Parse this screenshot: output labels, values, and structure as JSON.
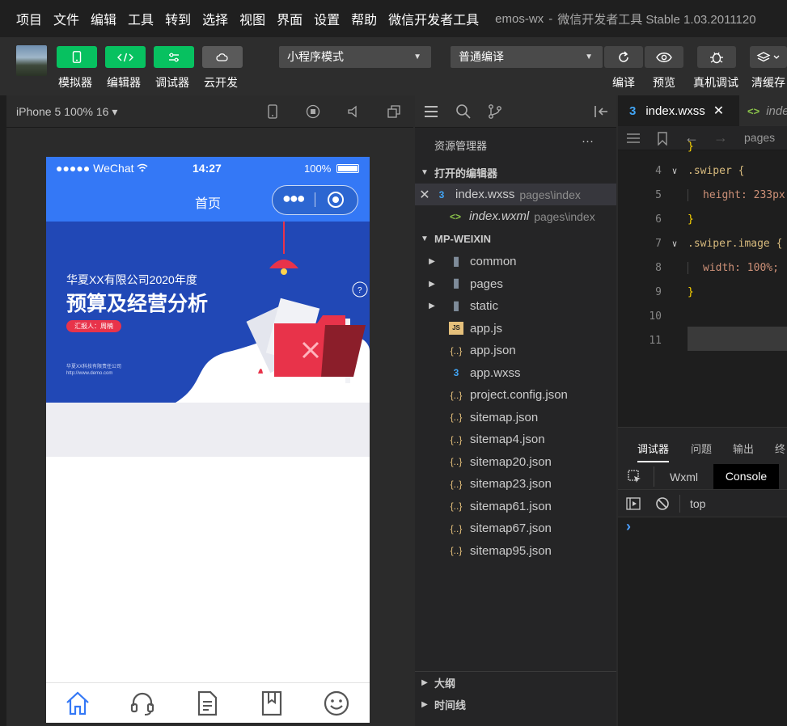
{
  "menubar": {
    "items": [
      "项目",
      "文件",
      "编辑",
      "工具",
      "转到",
      "选择",
      "视图",
      "界面",
      "设置",
      "帮助",
      "微信开发者工具"
    ],
    "title_app": "emos-wx",
    "title_sep": "-",
    "title_rest": "微信开发者工具 Stable 1.03.2011120"
  },
  "toolbar": {
    "buttons": [
      {
        "label": "模拟器",
        "icon": "phone-icon"
      },
      {
        "label": "编辑器",
        "icon": "code-icon"
      },
      {
        "label": "调试器",
        "icon": "debug-icon"
      },
      {
        "label": "云开发",
        "icon": "cloud-icon"
      }
    ],
    "mode_select": "小程序模式",
    "compile_select": "普通编译",
    "right_buttons": [
      {
        "label": "编译",
        "icon": "refresh-icon"
      },
      {
        "label": "预览",
        "icon": "eye-icon"
      },
      {
        "label": "真机调试",
        "icon": "bug-icon"
      },
      {
        "label": "清缓存",
        "icon": "layers-icon"
      }
    ]
  },
  "simulator": {
    "device_select": "iPhone 5 100% 16 ▾",
    "status": {
      "carrier": "●●●●● WeChat",
      "time": "14:27",
      "battery": "100%"
    },
    "nav_title": "首页",
    "banner": {
      "company": "华夏XX有限公司2020年度",
      "headline": "预算及经营分析",
      "reporter": "汇报人：周楠",
      "footer1": "华夏XX科技有限责任公司",
      "footer2": "http://www.demo.com"
    },
    "tabbar_icons": [
      "home-icon",
      "headset-icon",
      "document-icon",
      "bookmark-icon",
      "smile-icon"
    ]
  },
  "explorer": {
    "title": "资源管理器",
    "more": "···",
    "open_editors_label": "打开的编辑器",
    "open_editors": [
      {
        "name": "index.wxss",
        "path": "pages\\index"
      },
      {
        "name": "index.wxml",
        "path": "pages\\index"
      }
    ],
    "project_label": "MP-WEIXIN",
    "files": [
      {
        "name": "common",
        "kind": "folder"
      },
      {
        "name": "pages",
        "kind": "folder"
      },
      {
        "name": "static",
        "kind": "folder"
      },
      {
        "name": "app.js",
        "kind": "js"
      },
      {
        "name": "app.json",
        "kind": "json"
      },
      {
        "name": "app.wxss",
        "kind": "wxss"
      },
      {
        "name": "project.config.json",
        "kind": "json"
      },
      {
        "name": "sitemap.json",
        "kind": "json"
      },
      {
        "name": "sitemap4.json",
        "kind": "json"
      },
      {
        "name": "sitemap20.json",
        "kind": "json"
      },
      {
        "name": "sitemap23.json",
        "kind": "json"
      },
      {
        "name": "sitemap61.json",
        "kind": "json"
      },
      {
        "name": "sitemap67.json",
        "kind": "json"
      },
      {
        "name": "sitemap95.json",
        "kind": "json"
      }
    ],
    "outline_label": "大纲",
    "timeline_label": "时间线"
  },
  "editor": {
    "tabs": [
      {
        "name": "index.wxss"
      },
      {
        "name": "inde"
      }
    ],
    "breadcrumb": "pages",
    "lines": [
      {
        "n": "",
        "code": "}"
      },
      {
        "n": "4",
        "code": ".swiper {"
      },
      {
        "n": "5",
        "code": "height: 233px"
      },
      {
        "n": "6",
        "code": "}"
      },
      {
        "n": "7",
        "code": ".swiper.image {"
      },
      {
        "n": "8",
        "code": "width: 100%;"
      },
      {
        "n": "9",
        "code": "}"
      },
      {
        "n": "10",
        "code": ""
      },
      {
        "n": "11",
        "code": ""
      }
    ]
  },
  "debugger": {
    "tabs": [
      "调试器",
      "问题",
      "输出",
      "终"
    ],
    "subtabs": [
      "Wxml",
      "Console"
    ],
    "context": "top",
    "prompt": "›"
  },
  "colors": {
    "green": "#07c160",
    "blue_nav": "#3478f6",
    "banner": "#2148b6",
    "accent_red": "#e8334a"
  }
}
